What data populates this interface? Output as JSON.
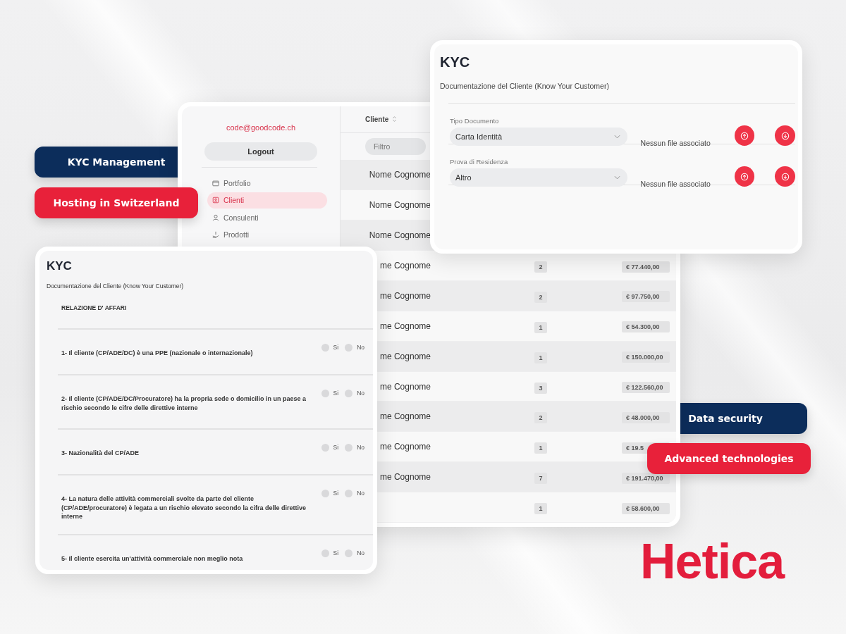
{
  "badges": [
    {
      "label": "KYC Management",
      "color": "#0c2d5b"
    },
    {
      "label": "Hosting in Switzerland",
      "color": "#e8213a"
    },
    {
      "label": "Data security",
      "color": "#0c2d5b"
    },
    {
      "label": "Advanced technologies",
      "color": "#e8213a"
    }
  ],
  "clients_window": {
    "sidebar": {
      "email": "code@goodcode.ch",
      "logout": "Logout",
      "items": [
        {
          "label": "Portfolio",
          "selected": false
        },
        {
          "label": "Clienti",
          "selected": true
        },
        {
          "label": "Consulenti",
          "selected": false
        },
        {
          "label": "Prodotti",
          "selected": false
        }
      ]
    },
    "table": {
      "column": "Cliente",
      "filter": {
        "placeholder": "Filtro"
      },
      "rows": [
        {
          "name": "Nome Cognome"
        },
        {
          "name": "Nome Cognome"
        },
        {
          "name": "Nome Cognome"
        },
        {
          "name": "me Cognome",
          "count": "2",
          "amount": "€ 77.440,00"
        },
        {
          "name": "me Cognome",
          "count": "2",
          "amount": "€ 97.750,00"
        },
        {
          "name": "me Cognome",
          "count": "1",
          "amount": "€ 54.300,00"
        },
        {
          "name": "me Cognome",
          "count": "1",
          "amount": "€ 150.000,00"
        },
        {
          "name": "me Cognome",
          "count": "3",
          "amount": "€ 122.560,00"
        },
        {
          "name": "me Cognome",
          "count": "2",
          "amount": "€ 48.000,00"
        },
        {
          "name": "me Cognome",
          "count": "1",
          "amount": "€ 19.5"
        },
        {
          "name": "me Cognome",
          "count": "7",
          "amount": "€ 191.470,00"
        },
        {
          "count": "1",
          "amount": "€ 58.600,00"
        }
      ]
    }
  },
  "kyc_documents": {
    "title": "KYC",
    "subtitle": "Documentazione del Cliente (Know Your Customer)",
    "rows": [
      {
        "label": "Tipo Documento",
        "value": "Carta Identità",
        "file": "Nessun file associato"
      },
      {
        "label": "Prova di Residenza",
        "value": "Altro",
        "file": "Nessun file associato"
      }
    ]
  },
  "kyc_questions": {
    "title": "KYC",
    "subtitle": "Documentazione del Cliente (Know Your Customer)",
    "section": "RELAZIONE D' AFFARI",
    "questions": [
      {
        "text": "1- Il cliente (CP/ADE/DC) è una PPE (nazionale o internazionale)",
        "options": [
          {
            "label": "Si",
            "selected": false
          },
          {
            "label": "No",
            "selected": false
          }
        ]
      },
      {
        "text": "2- Il cliente (CP/ADE/DC/Procuratore) ha la propria sede o domicilio in un paese a rischio secondo le cifre delle direttive interne",
        "options": [
          {
            "label": "Si",
            "selected": false
          },
          {
            "label": "No",
            "selected": false
          }
        ]
      },
      {
        "text": "3- Nazionalità del CP/ADE",
        "options": [
          {
            "label": "Si",
            "selected": false
          },
          {
            "label": "No",
            "selected": false
          }
        ]
      },
      {
        "text": "4- La natura delle attività commerciali svolte da parte del cliente (CP/ADE/procuratore) è legata a un rischio elevato secondo la cifra delle direttive interne",
        "options": [
          {
            "label": "Si",
            "selected": false
          },
          {
            "label": "No",
            "selected": false
          }
        ]
      },
      {
        "text": "5- Il cliente esercita un'attività commerciale non meglio nota",
        "options": [
          {
            "label": "Si",
            "selected": false
          },
          {
            "label": "No",
            "selected": false
          }
        ]
      }
    ]
  },
  "logo": "Hetica"
}
